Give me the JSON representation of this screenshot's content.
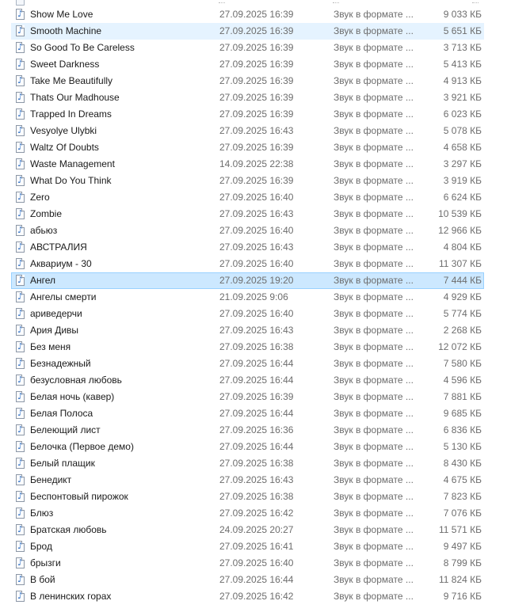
{
  "icon": "audio-file-icon",
  "files": [
    {
      "name": "Show Me Love",
      "date": "27.09.2025 16:39",
      "type": "Звук в формате ...",
      "size": "9 033 КБ"
    },
    {
      "name": "Smooth Machine",
      "date": "27.09.2025 16:39",
      "type": "Звук в формате ...",
      "size": "5 651 КБ"
    },
    {
      "name": "So Good To Be Careless",
      "date": "27.09.2025 16:39",
      "type": "Звук в формате ...",
      "size": "3 713 КБ"
    },
    {
      "name": "Sweet Darkness",
      "date": "27.09.2025 16:39",
      "type": "Звук в формате ...",
      "size": "5 413 КБ"
    },
    {
      "name": "Take Me Beautifully",
      "date": "27.09.2025 16:39",
      "type": "Звук в формате ...",
      "size": "4 913 КБ"
    },
    {
      "name": "Thats Our Madhouse",
      "date": "27.09.2025 16:39",
      "type": "Звук в формате ...",
      "size": "3 921 КБ"
    },
    {
      "name": "Trapped In Dreams",
      "date": "27.09.2025 16:39",
      "type": "Звук в формате ...",
      "size": "6 023 КБ"
    },
    {
      "name": "Vesyolye Ulybki",
      "date": "27.09.2025 16:43",
      "type": "Звук в формате ...",
      "size": "5 078 КБ"
    },
    {
      "name": "Waltz Of Doubts",
      "date": "27.09.2025 16:39",
      "type": "Звук в формате ...",
      "size": "4 658 КБ"
    },
    {
      "name": "Waste Management",
      "date": "14.09.2025 22:38",
      "type": "Звук в формате ...",
      "size": "3 297 КБ"
    },
    {
      "name": "What Do You Think",
      "date": "27.09.2025 16:39",
      "type": "Звук в формате ...",
      "size": "3 919 КБ"
    },
    {
      "name": "Zero",
      "date": "27.09.2025 16:40",
      "type": "Звук в формате ...",
      "size": "6 624 КБ"
    },
    {
      "name": "Zombie",
      "date": "27.09.2025 16:43",
      "type": "Звук в формате ...",
      "size": "10 539 КБ"
    },
    {
      "name": "абьюз",
      "date": "27.09.2025 16:40",
      "type": "Звук в формате ...",
      "size": "12 966 КБ"
    },
    {
      "name": "АВСТРАЛИЯ",
      "date": "27.09.2025 16:43",
      "type": "Звук в формате ...",
      "size": "4 804 КБ"
    },
    {
      "name": "Аквариум - 30",
      "date": "27.09.2025 16:40",
      "type": "Звук в формате ...",
      "size": "11 307 КБ"
    },
    {
      "name": "Ангел",
      "date": "27.09.2025 19:20",
      "type": "Звук в формате ...",
      "size": "7 444 КБ"
    },
    {
      "name": "Ангелы смерти",
      "date": "21.09.2025 9:06",
      "type": "Звук в формате ...",
      "size": "4 929 КБ"
    },
    {
      "name": "ариведерчи",
      "date": "27.09.2025 16:40",
      "type": "Звук в формате ...",
      "size": "5 774 КБ"
    },
    {
      "name": "Ария Дивы",
      "date": "27.09.2025 16:43",
      "type": "Звук в формате ...",
      "size": "2 268 КБ"
    },
    {
      "name": "Без меня",
      "date": "27.09.2025 16:38",
      "type": "Звук в формате ...",
      "size": "12 072 КБ"
    },
    {
      "name": "Безнадежный",
      "date": "27.09.2025 16:44",
      "type": "Звук в формате ...",
      "size": "7 580 КБ"
    },
    {
      "name": "безусловная любовь",
      "date": "27.09.2025 16:44",
      "type": "Звук в формате ...",
      "size": "4 596 КБ"
    },
    {
      "name": "Белая ночь (кавер)",
      "date": "27.09.2025 16:39",
      "type": "Звук в формате ...",
      "size": "7 881 КБ"
    },
    {
      "name": "Белая Полоса",
      "date": "27.09.2025 16:44",
      "type": "Звук в формате ...",
      "size": "9 685 КБ"
    },
    {
      "name": "Белеющий лист",
      "date": "27.09.2025 16:36",
      "type": "Звук в формате ...",
      "size": "6 836 КБ"
    },
    {
      "name": "Белочка (Первое демо)",
      "date": "27.09.2025 16:44",
      "type": "Звук в формате ...",
      "size": "5 130 КБ"
    },
    {
      "name": "Белый плащик",
      "date": "27.09.2025 16:38",
      "type": "Звук в формате ...",
      "size": "8 430 КБ"
    },
    {
      "name": "Бенедикт",
      "date": "27.09.2025 16:43",
      "type": "Звук в формате ...",
      "size": "4 675 КБ"
    },
    {
      "name": "Беспонтовый пирожок",
      "date": "27.09.2025 16:38",
      "type": "Звук в формате ...",
      "size": "7 823 КБ"
    },
    {
      "name": "Блюз",
      "date": "27.09.2025 16:42",
      "type": "Звук в формате ...",
      "size": "7 076 КБ"
    },
    {
      "name": "Братская любовь",
      "date": "24.09.2025 20:27",
      "type": "Звук в формате ...",
      "size": "11 571 КБ"
    },
    {
      "name": "Брод",
      "date": "27.09.2025 16:41",
      "type": "Звук в формате ...",
      "size": "9 497 КБ"
    },
    {
      "name": "брызги",
      "date": "27.09.2025 16:40",
      "type": "Звук в формате ...",
      "size": "8 799 КБ"
    },
    {
      "name": "В бой",
      "date": "27.09.2025 16:44",
      "type": "Звук в формате ...",
      "size": "11 824 КБ"
    },
    {
      "name": "В ленинских горах",
      "date": "27.09.2025 16:42",
      "type": "Звук в формате ...",
      "size": "9 716 КБ"
    }
  ]
}
